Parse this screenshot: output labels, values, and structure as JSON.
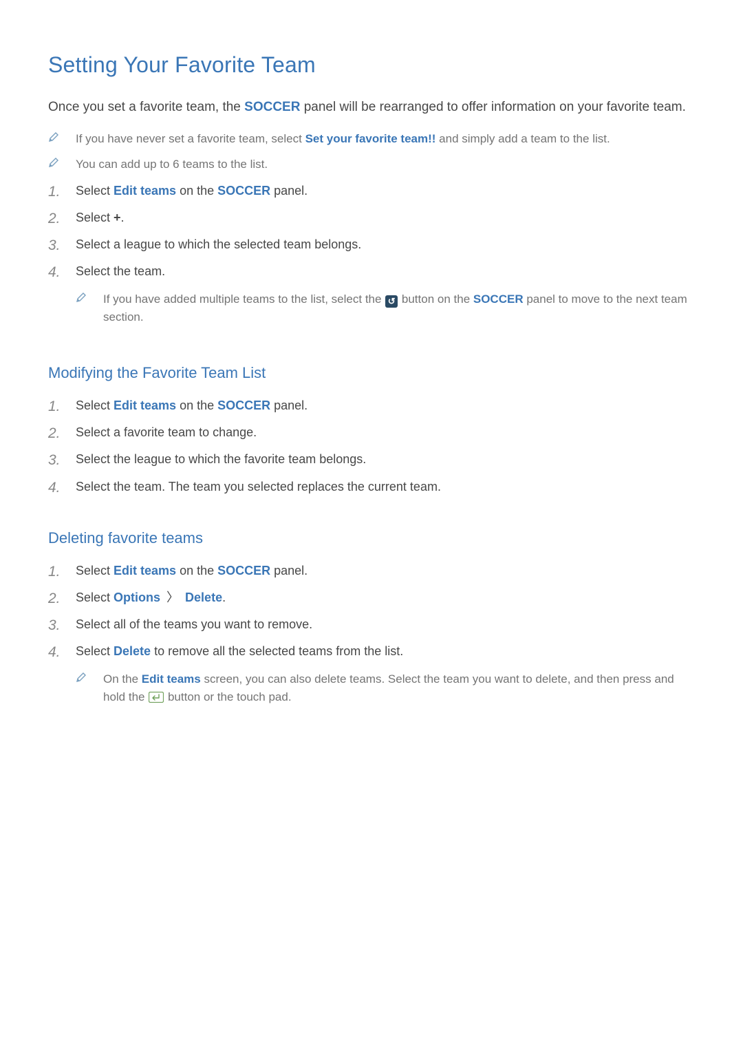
{
  "title": "Setting Your Favorite Team",
  "intro": {
    "pre": "Once you set a favorite team, the ",
    "accent": "SOCCER",
    "post": " panel will be rearranged to offer information on your favorite team."
  },
  "top_notes": [
    {
      "pre": "If you have never set a favorite team, select ",
      "accent": "Set your favorite team!!",
      "post": " and simply add a team to the list."
    },
    {
      "text": "You can add up to 6 teams to the list."
    }
  ],
  "steps_main": [
    {
      "num": "1.",
      "parts": [
        "Select ",
        {
          "accent": "Edit teams"
        },
        " on the ",
        {
          "accent": "SOCCER"
        },
        " panel."
      ]
    },
    {
      "num": "2.",
      "parts": [
        "Select ",
        {
          "strong": "+"
        },
        "."
      ]
    },
    {
      "num": "3.",
      "parts": [
        "Select a league to which the selected team belongs."
      ]
    },
    {
      "num": "4.",
      "parts": [
        "Select the team."
      ],
      "nested_note": {
        "pre": "If you have added multiple teams to the list, select the ",
        "mid": " button on the ",
        "accent": "SOCCER",
        "post": " panel to move to the next team section."
      }
    }
  ],
  "section_modify": {
    "title": "Modifying the Favorite Team List",
    "steps": [
      {
        "num": "1.",
        "parts": [
          "Select ",
          {
            "accent": "Edit teams"
          },
          " on the ",
          {
            "accent": "SOCCER"
          },
          " panel."
        ]
      },
      {
        "num": "2.",
        "parts": [
          "Select a favorite team to change."
        ]
      },
      {
        "num": "3.",
        "parts": [
          "Select the league to which the favorite team belongs."
        ]
      },
      {
        "num": "4.",
        "parts": [
          "Select the team. The team you selected replaces the current team."
        ]
      }
    ]
  },
  "section_delete": {
    "title": "Deleting favorite teams",
    "steps": [
      {
        "num": "1.",
        "parts": [
          "Select ",
          {
            "accent": "Edit teams"
          },
          " on the ",
          {
            "accent": "SOCCER"
          },
          " panel."
        ]
      },
      {
        "num": "2.",
        "parts": [
          "Select ",
          {
            "accent": "Options"
          },
          {
            "gt": " 〉 "
          },
          {
            "accent": "Delete"
          },
          "."
        ]
      },
      {
        "num": "3.",
        "parts": [
          "Select all of the teams you want to remove."
        ]
      },
      {
        "num": "4.",
        "parts": [
          "Select ",
          {
            "accent": "Delete"
          },
          " to remove all the selected teams from the list."
        ],
        "nested_note": {
          "pre": "On the ",
          "accent1": "Edit teams",
          "mid": " screen, you can also delete teams. Select the team you want to delete, and then press and hold the ",
          "post": " button or the touch pad."
        }
      }
    ]
  }
}
